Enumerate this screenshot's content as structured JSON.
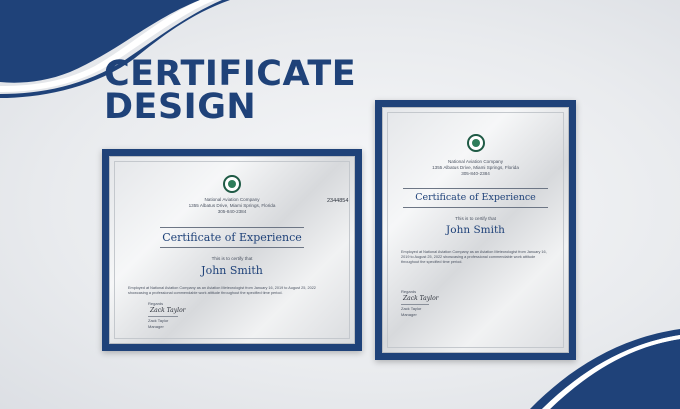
{
  "headline": {
    "line1": "CERTIFICATE",
    "line2": "DESIGN"
  },
  "certificate": {
    "company": "National Aviation Company",
    "address": "1355 Albatus Drive, Miami Springs, Florida",
    "phone": "305-840-2384",
    "title": "Certificate of Experience",
    "intro": "This is to certify that",
    "recipient": "John Smith",
    "body": "Employed at National Aviation Company as an Aviation Meteorologist from January 16, 2019 to August 25, 2022 showcasing a professional commendable work attitude throughout the specified time period.",
    "regards": "Regards",
    "signature": "Zack Taylor",
    "signer_name": "Zack Taylor",
    "signer_role": "Manager"
  },
  "stray_text": "2344854",
  "colors": {
    "brand_navy": "#1f4279",
    "seal_green": "#2e7d5a"
  }
}
